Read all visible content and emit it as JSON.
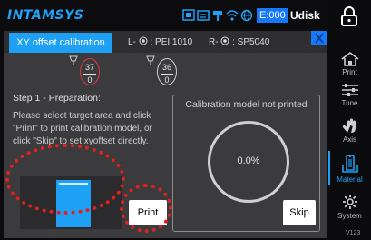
{
  "status_bar": {
    "brand": "INTAMSYS",
    "error_code": "E:000",
    "storage": "Udisk"
  },
  "panel": {
    "tab_title": "XY offset calibration",
    "nozzle_left_label": "L-",
    "nozzle_left_material": ": PEI 1010",
    "nozzle_right_label": "R-",
    "nozzle_right_material": ": SP5040",
    "temps": [
      {
        "current": "37",
        "target": "0"
      },
      {
        "current": "36",
        "target": "0"
      }
    ],
    "step_title": "Step 1 - Preparation:",
    "step_desc": "Please select target area and click \"Print\" to print calibration model, or click \"Skip\" to set xyoffset directly.",
    "print_button": "Print",
    "preview_title": "Calibration model not printed",
    "progress": "0.0%",
    "skip_button": "Skip"
  },
  "sidebar": {
    "items": [
      {
        "label": "Print",
        "icon": "home-icon"
      },
      {
        "label": "Tune",
        "icon": "sliders-icon"
      },
      {
        "label": "Axis",
        "icon": "hand-icon"
      },
      {
        "label": "Material",
        "icon": "material-icon"
      },
      {
        "label": "System",
        "icon": "gear-icon"
      }
    ],
    "version": "V123"
  },
  "colors": {
    "accent": "#1ea0f5",
    "annotation": "#e02020"
  }
}
